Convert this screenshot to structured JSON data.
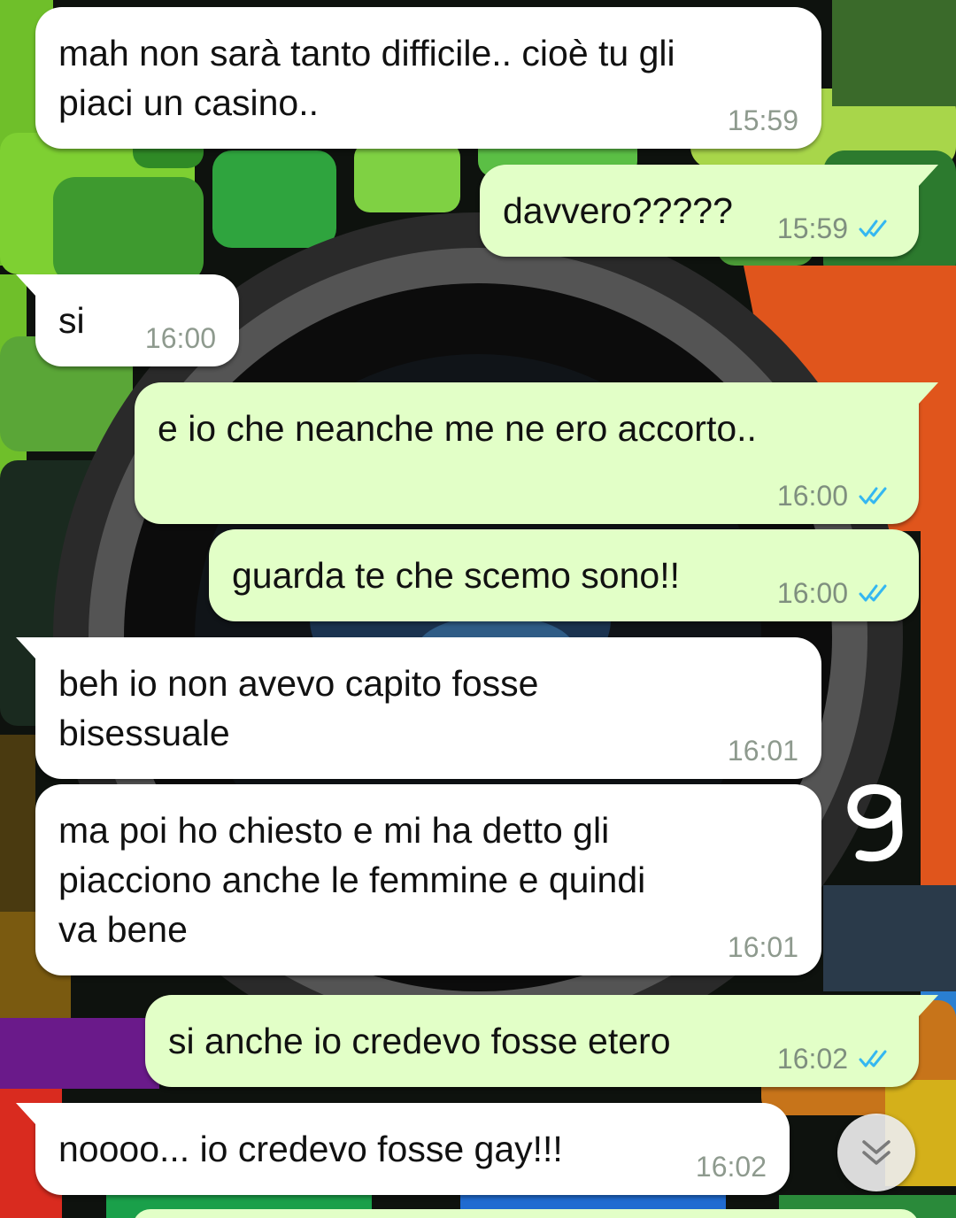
{
  "colors": {
    "incoming_bubble": "#ffffff",
    "outgoing_bubble": "#e2ffc7",
    "read_ticks": "#34b7f1",
    "timestamp": "#8e9a8e"
  },
  "messages": [
    {
      "direction": "in",
      "text": "mah non sarà tanto difficile.. cioè tu gli\npiaci un casino..",
      "time": "15:59"
    },
    {
      "direction": "out",
      "text": "davvero?????",
      "time": "15:59",
      "status": "read"
    },
    {
      "direction": "in",
      "text": "si",
      "time": "16:00"
    },
    {
      "direction": "out",
      "text": "e io che neanche me ne ero accorto..",
      "time": "16:00",
      "status": "read"
    },
    {
      "direction": "out",
      "text": "guarda te che scemo sono!!",
      "time": "16:00",
      "status": "read"
    },
    {
      "direction": "in",
      "text": "beh io non avevo capito fosse\nbisessuale",
      "time": "16:01"
    },
    {
      "direction": "in",
      "text": "ma poi ho chiesto e mi ha detto gli\npiacciono anche le femmine e quindi\nva bene",
      "time": "16:01"
    },
    {
      "direction": "out",
      "text": "si anche io credevo fosse etero",
      "time": "16:02",
      "status": "read"
    },
    {
      "direction": "in",
      "text": "noooo... io credevo fosse gay!!!",
      "time": "16:02"
    }
  ],
  "icons": {
    "read_receipt": "double-check-icon",
    "scroll_down": "double-chevron-down-icon"
  },
  "annotation": {
    "handwritten_number": "9"
  }
}
